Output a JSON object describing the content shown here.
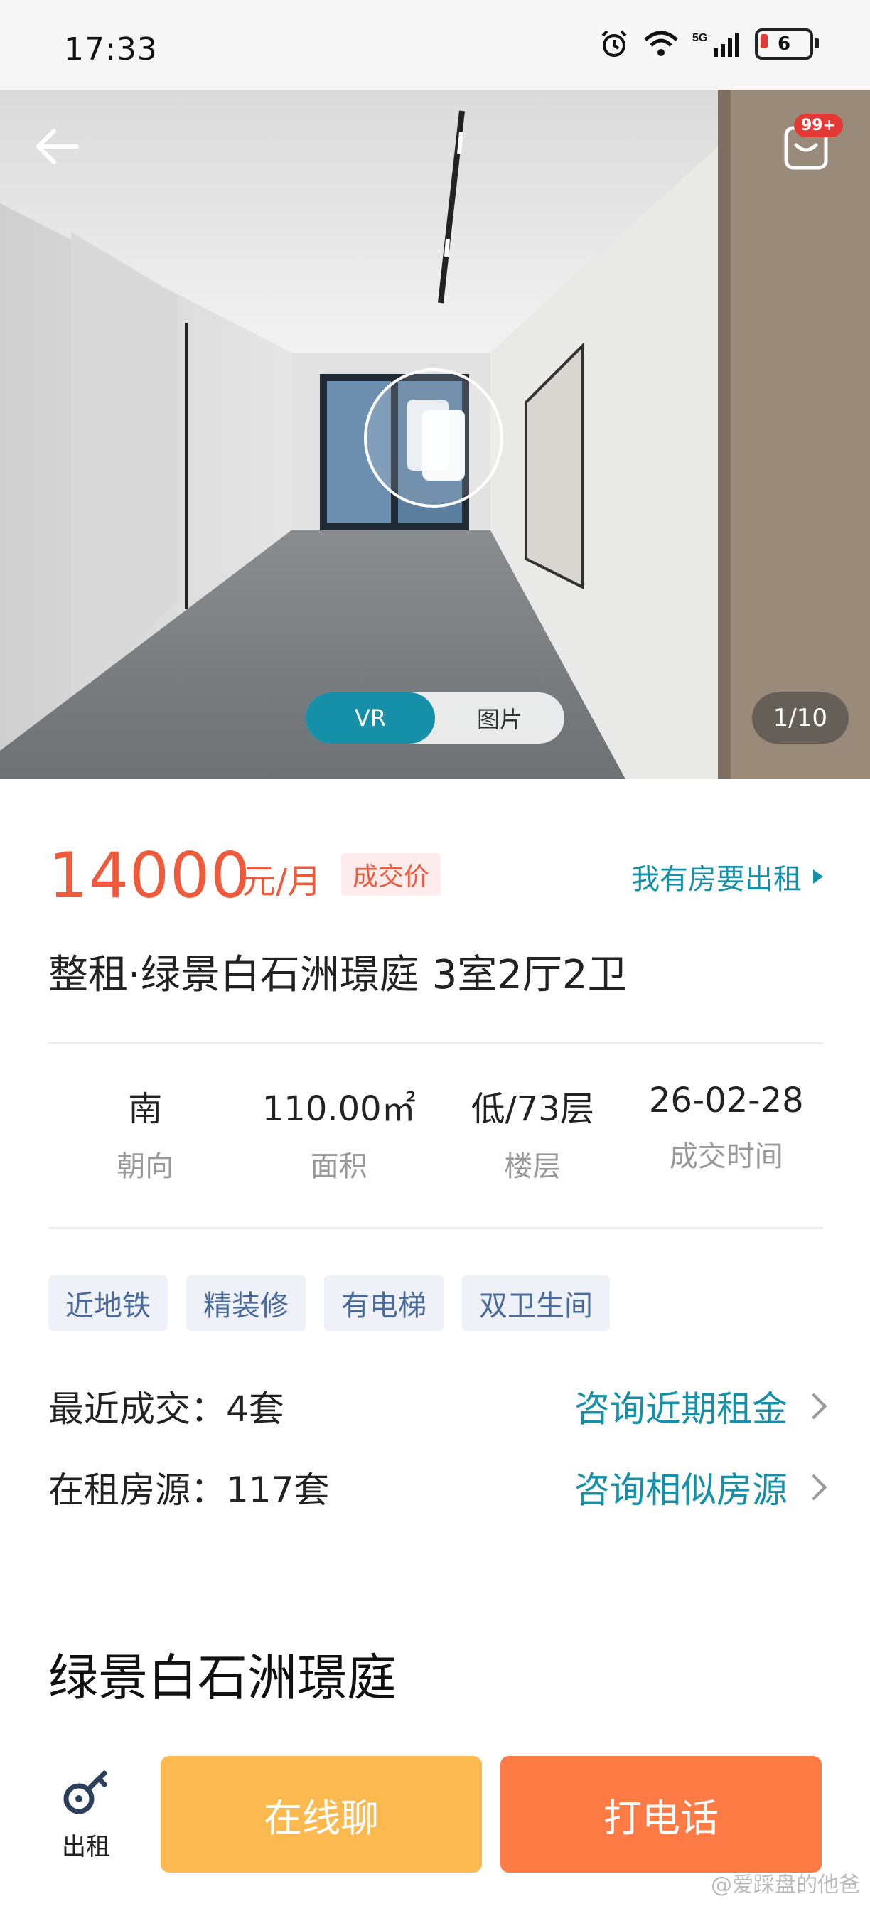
{
  "status_bar": {
    "time": "17:33",
    "battery": "6"
  },
  "hero": {
    "badge": "99+",
    "toggle": {
      "vr": "VR",
      "photo": "图片"
    },
    "counter": "1/10"
  },
  "listing": {
    "price": "14000",
    "unit": "元/月",
    "deal_tag": "成交价",
    "rent_link": "我有房要出租",
    "title": "整租·绿景白石洲璟庭 3室2厅2卫",
    "stats": [
      {
        "value": "南",
        "label": "朝向"
      },
      {
        "value": "110.00㎡",
        "label": "面积"
      },
      {
        "value": "低/73层",
        "label": "楼层"
      },
      {
        "value": "26-02-28",
        "label": "成交时间"
      }
    ],
    "tags": [
      "近地铁",
      "精装修",
      "有电梯",
      "双卫生间"
    ],
    "recent_deals": {
      "label": "最近成交：4套",
      "action": "咨询近期租金"
    },
    "on_rent": {
      "label": "在租房源：117套",
      "action": "咨询相似房源"
    }
  },
  "section": {
    "community": "绿景白石洲璟庭"
  },
  "bottom": {
    "rent_label": "出租",
    "chat": "在线聊",
    "call": "打电话"
  },
  "watermark": "@爱踩盘的他爸"
}
